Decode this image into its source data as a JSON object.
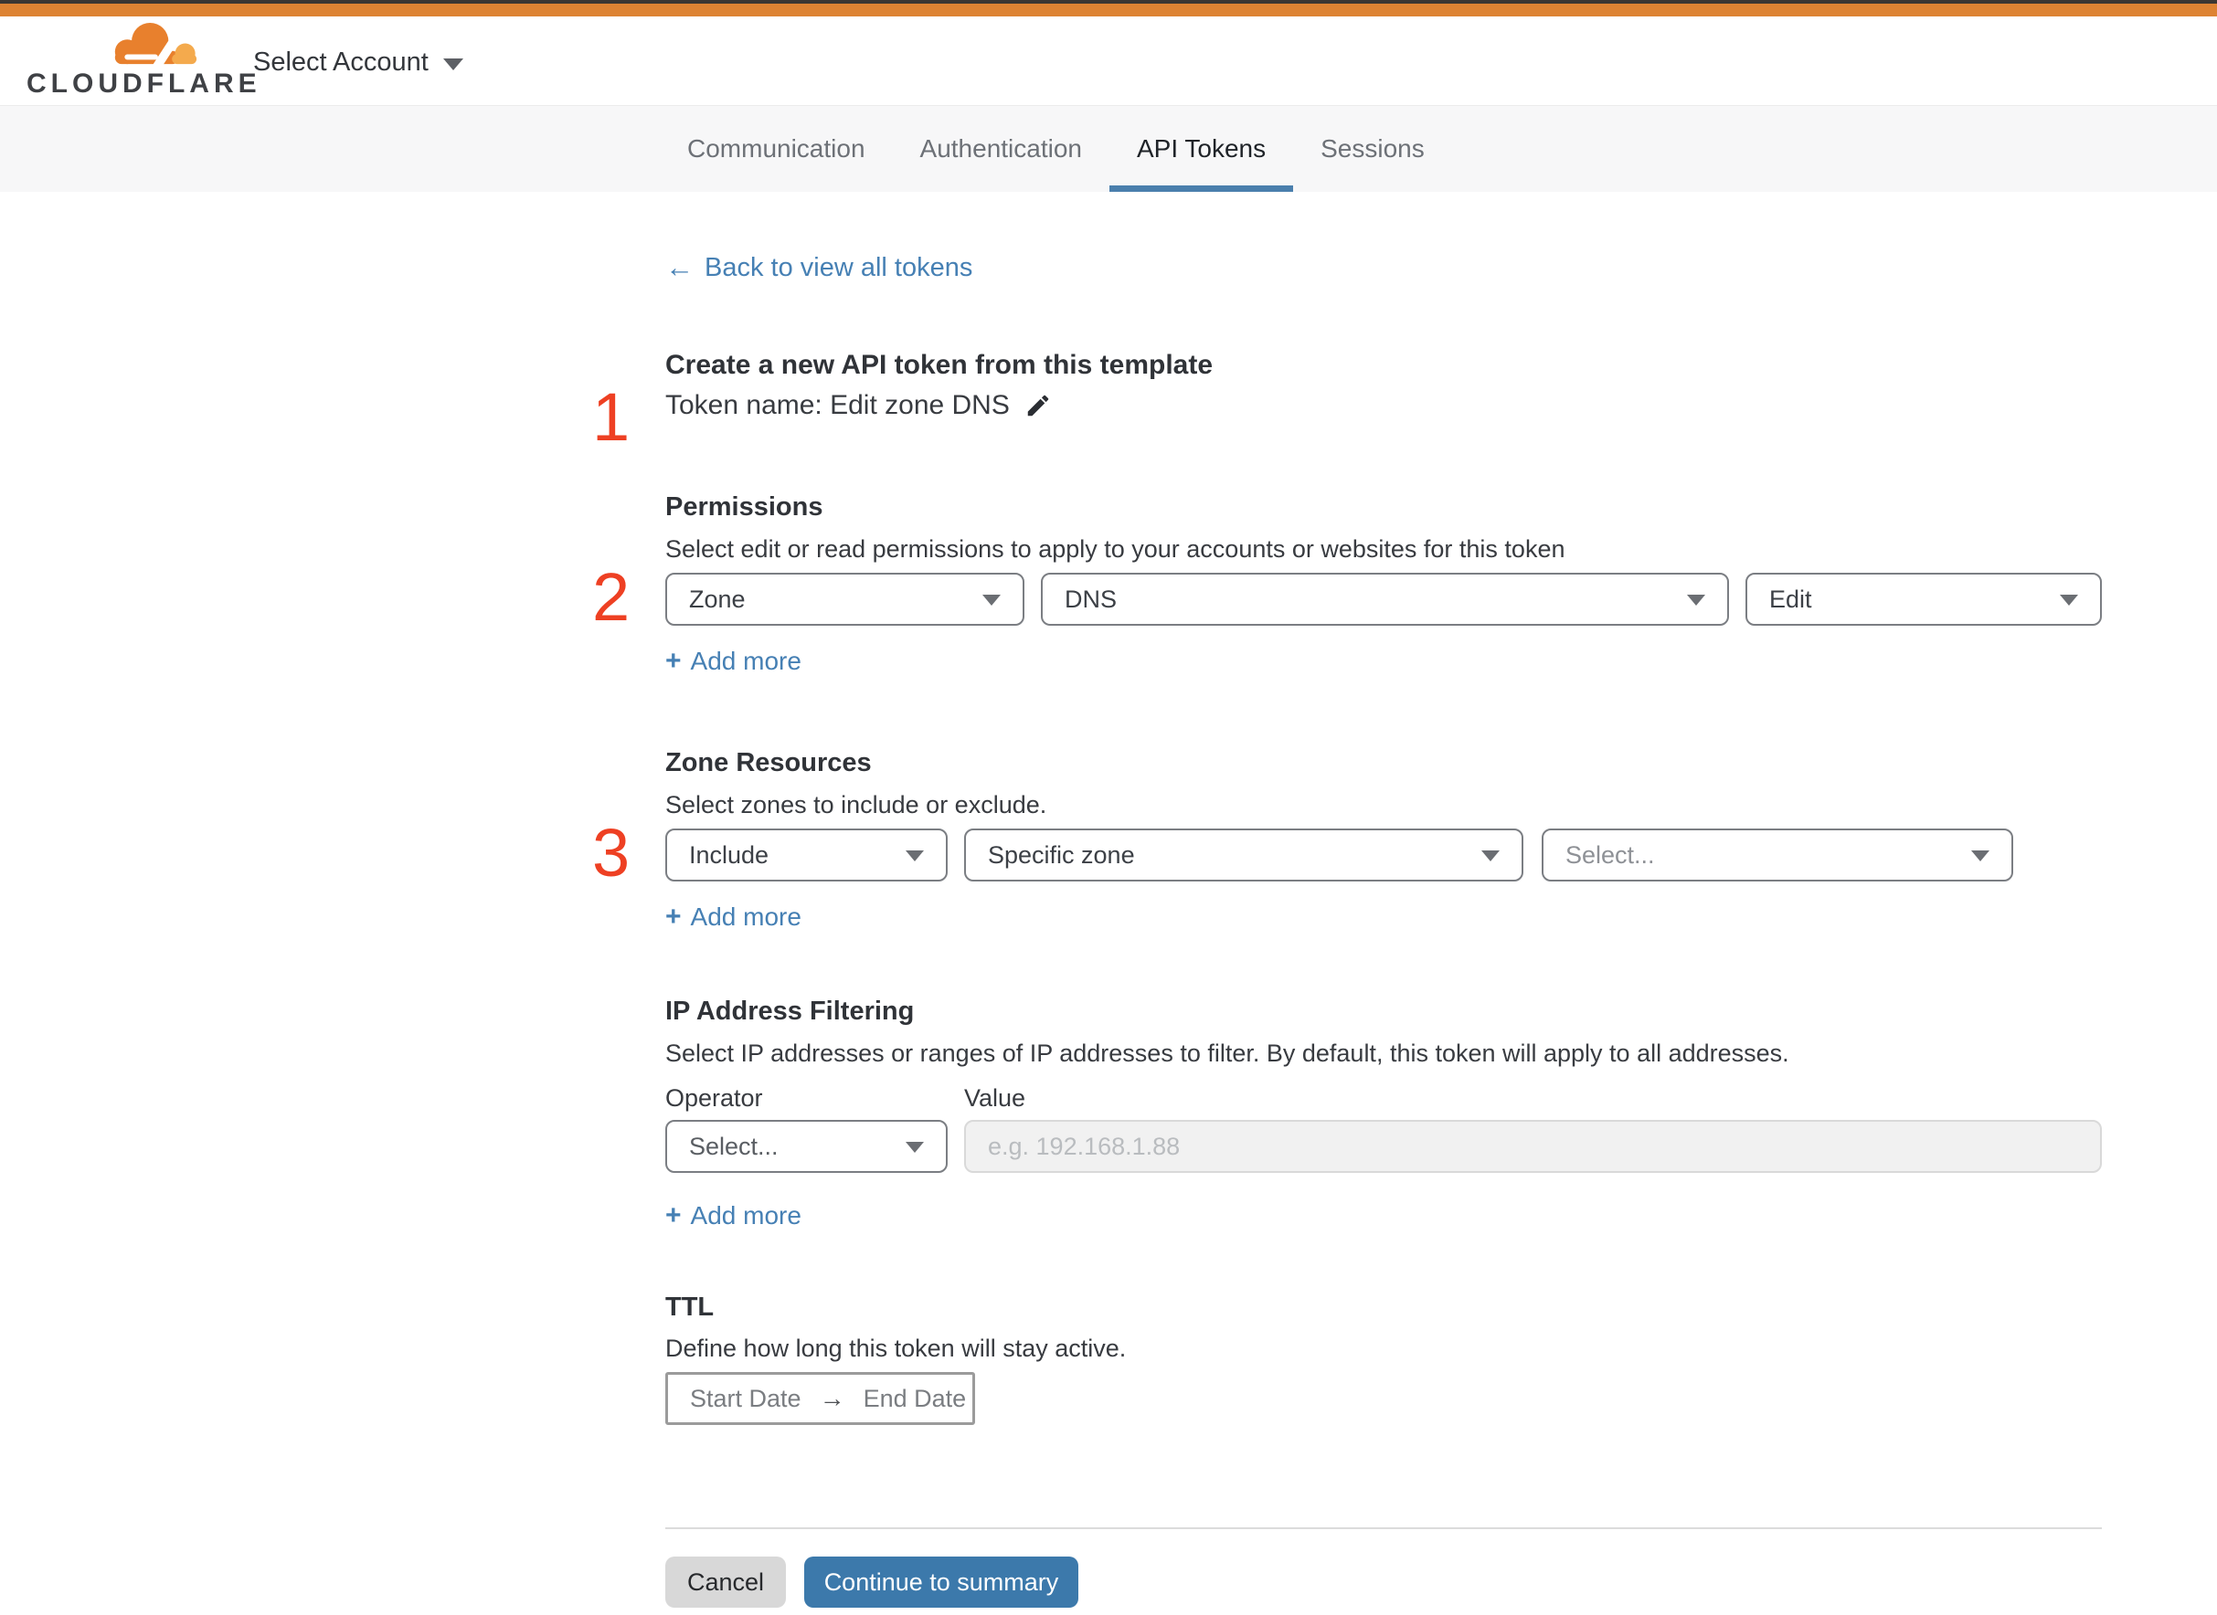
{
  "header": {
    "brand": "CLOUDFLARE",
    "account_selector": "Select Account"
  },
  "tabs": [
    {
      "label": "Communication",
      "active": false
    },
    {
      "label": "Authentication",
      "active": false
    },
    {
      "label": "API Tokens",
      "active": true
    },
    {
      "label": "Sessions",
      "active": false
    }
  ],
  "back_link": "Back to view all tokens",
  "icons": {
    "back_arrow": "←",
    "range_arrow": "→"
  },
  "add_more": {
    "plus": "+",
    "label": "Add more"
  },
  "token_section": {
    "step": "1",
    "heading": "Create a new API token from this template",
    "token_name": "Token name: Edit zone DNS"
  },
  "permissions": {
    "step": "2",
    "title": "Permissions",
    "description": "Select edit or read permissions to apply to your accounts or websites for this token",
    "selects": [
      {
        "value": "Zone"
      },
      {
        "value": "DNS"
      },
      {
        "value": "Edit"
      }
    ]
  },
  "zone_resources": {
    "step": "3",
    "title": "Zone Resources",
    "description": "Select zones to include or exclude.",
    "selects": [
      {
        "value": "Include"
      },
      {
        "value": "Specific zone"
      },
      {
        "value": "Select..."
      }
    ]
  },
  "ip_filtering": {
    "title": "IP Address Filtering",
    "description": "Select IP addresses or ranges of IP addresses to filter. By default, this token will apply to all addresses.",
    "operator_label": "Operator",
    "value_label": "Value",
    "operator_value": "Select...",
    "value_placeholder": "e.g. 192.168.1.88"
  },
  "ttl": {
    "title": "TTL",
    "description": "Define how long this token will stay active.",
    "start_placeholder": "Start Date",
    "end_placeholder": "End Date"
  },
  "footer": {
    "cancel_label": "Cancel",
    "continue_label": "Continue to summary"
  },
  "colors": {
    "topbar_dark": "#3b3733",
    "topbar_orange": "#dd8333",
    "brand_cloud_orange": "#e8802d",
    "brand_cloud_amber": "#f4aa4d",
    "step_number_red": "#ee4023",
    "link_blue": "#4680b4",
    "tab_underline_blue": "#4a7fad",
    "continue_button_blue": "#3c79ab",
    "cancel_button_gray": "#d8d8d8",
    "tabbar_background": "#f7f7f8"
  }
}
